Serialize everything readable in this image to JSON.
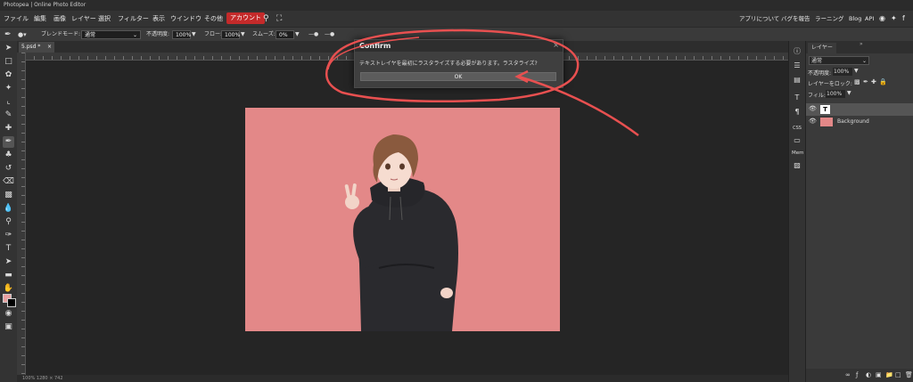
{
  "window": {
    "title": "Photopea | Online Photo Editor"
  },
  "menu": {
    "items": [
      "ファイル",
      "編集",
      "画像",
      "レイヤー",
      "選択",
      "フィルター",
      "表示",
      "ウインドウ",
      "その他"
    ],
    "account": "アカウント",
    "right_links": [
      "アプリについて",
      "バグを報告",
      "ラーニング",
      "Blog",
      "API"
    ]
  },
  "options": {
    "blend_label": "ブレンドモード:",
    "blend_value": "通常",
    "opacity_label": "不透明度:",
    "opacity_value": "100%",
    "flow_label": "フロー:",
    "flow_value": "100%",
    "smooth_label": "スムーズ:",
    "smooth_value": "0%"
  },
  "tab": {
    "name": "5.psd *",
    "close": "×"
  },
  "status": {
    "text": "100%    1280 × 742"
  },
  "dialog": {
    "title": "Confirm",
    "message": "テキストレイヤを最初にラスタライズする必要があります。ラスタライズ?",
    "ok_label": "OK",
    "close": "×"
  },
  "layers": {
    "tab_label": "レイヤー",
    "blend_value": "通常",
    "opacity_label": "不透明度:",
    "opacity_value": "100%",
    "lock_label": "レイヤーをロック:",
    "fill_label": "フィル:",
    "fill_value": "100%",
    "rows": [
      {
        "name": "",
        "type": "T"
      },
      {
        "name": "Background",
        "type": "image"
      }
    ]
  },
  "panel_strip": {
    "css_label": "CSS",
    "mem_label": "Mem"
  },
  "colors": {
    "canvas": "#e38888",
    "accent": "#c42a2a",
    "annotation": "#e85050"
  }
}
